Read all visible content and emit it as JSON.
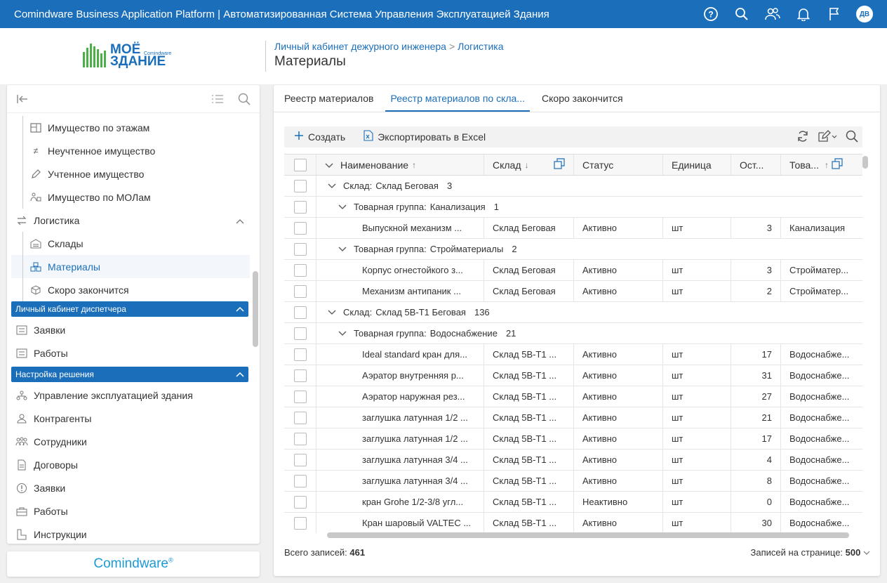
{
  "app": {
    "title": "Comindware Business Application Platform  |  Автоматизированная Система Управления Эксплуатацией Здания",
    "avatar": "ДВ",
    "logo_line1": "МОЁ",
    "logo_line2": "ЗДАНИЕ",
    "logo_small": "Comindware",
    "brand": "Comindware",
    "brand_mark": "®"
  },
  "breadcrumb": {
    "items": [
      "Личный кабинет дежурного инженера",
      "Логистика"
    ],
    "separator": ">",
    "page_title": "Материалы"
  },
  "sidebar": {
    "items": [
      {
        "label": "Имущество по этажам",
        "icon": "floor-plan-icon"
      },
      {
        "label": "Неучтенное имущество",
        "icon": "not-equal-icon"
      },
      {
        "label": "Учтенное имущество",
        "icon": "pencil-icon"
      },
      {
        "label": "Имущество по МОЛам",
        "icon": "person-box-icon"
      },
      {
        "label": "Логистика",
        "icon": "transfer-arrows-icon"
      },
      {
        "label": "Склады",
        "icon": "warehouse-icon"
      },
      {
        "label": "Материалы",
        "icon": "boxes-icon"
      },
      {
        "label": "Скоро закончится",
        "icon": "cube-icon"
      }
    ],
    "section_dispatcher": "Личный кабинет диспетчера",
    "dispatcher_items": [
      {
        "label": "Заявки",
        "icon": "list-icon"
      },
      {
        "label": "Работы",
        "icon": "list-icon"
      }
    ],
    "section_settings": "Настройка решения",
    "settings_items": [
      {
        "label": "Управление эксплуатацией здания",
        "icon": "sitemap-icon"
      },
      {
        "label": "Контрагенты",
        "icon": "contractor-icon"
      },
      {
        "label": "Сотрудники",
        "icon": "people-icon"
      },
      {
        "label": "Договоры",
        "icon": "document-icon"
      },
      {
        "label": "Заявки",
        "icon": "alert-circle-icon"
      },
      {
        "label": "Работы",
        "icon": "briefcase-icon"
      },
      {
        "label": "Инструкции",
        "icon": "instruction-icon"
      }
    ]
  },
  "tabs": [
    "Реестр материалов",
    "Реестр материалов по скла...",
    "Скоро закончится"
  ],
  "active_tab": 1,
  "toolbar": {
    "create": "Создать",
    "export": "Экспортировать в Excel"
  },
  "grid": {
    "headers": {
      "name": "Наименование",
      "warehouse": "Склад",
      "status": "Статус",
      "unit": "Единица",
      "remaining": "Ост...",
      "group": "Това..."
    },
    "sort_up": "↑",
    "sort_down": "↓",
    "rows": [
      {
        "kind": "group",
        "level": 0,
        "label": "Склад:",
        "value": "Склад Беговая",
        "count": "3"
      },
      {
        "kind": "group",
        "level": 1,
        "label": "Товарная группа:",
        "value": "Канализация",
        "count": "1"
      },
      {
        "kind": "data",
        "name": "Выпускной механизм ...",
        "warehouse": "Склад Беговая",
        "status": "Активно",
        "unit": "шт",
        "remaining": "3",
        "group": "Канализация"
      },
      {
        "kind": "group",
        "level": 1,
        "label": "Товарная группа:",
        "value": "Стройматериалы",
        "count": "2"
      },
      {
        "kind": "data",
        "name": "Корпус огнестойкого з...",
        "warehouse": "Склад Беговая",
        "status": "Активно",
        "unit": "шт",
        "remaining": "3",
        "group": "Стройматер..."
      },
      {
        "kind": "data",
        "name": "Механизм антипаник ...",
        "warehouse": "Склад Беговая",
        "status": "Активно",
        "unit": "шт",
        "remaining": "2",
        "group": "Стройматер..."
      },
      {
        "kind": "group",
        "level": 0,
        "label": "Склад:",
        "value": "Склад 5В-Т1 Беговая",
        "count": "136"
      },
      {
        "kind": "group",
        "level": 1,
        "label": "Товарная группа:",
        "value": "Водоснабжение",
        "count": "21"
      },
      {
        "kind": "data",
        "name": "Ideal standard кран для...",
        "warehouse": "Склад 5В-Т1 ...",
        "status": "Активно",
        "unit": "шт",
        "remaining": "17",
        "group": "Водоснабже..."
      },
      {
        "kind": "data",
        "name": "Аэратор внутренняя р...",
        "warehouse": "Склад 5В-Т1 ...",
        "status": "Активно",
        "unit": "шт",
        "remaining": "31",
        "group": "Водоснабже..."
      },
      {
        "kind": "data",
        "name": "Аэратор наружная рез...",
        "warehouse": "Склад 5В-Т1 ...",
        "status": "Активно",
        "unit": "шт",
        "remaining": "27",
        "group": "Водоснабже..."
      },
      {
        "kind": "data",
        "name": "заглушка латунная 1/2 ...",
        "warehouse": "Склад 5В-Т1 ...",
        "status": "Активно",
        "unit": "шт",
        "remaining": "21",
        "group": "Водоснабже..."
      },
      {
        "kind": "data",
        "name": "заглушка латунная 1/2 ...",
        "warehouse": "Склад 5В-Т1 ...",
        "status": "Активно",
        "unit": "шт",
        "remaining": "17",
        "group": "Водоснабже..."
      },
      {
        "kind": "data",
        "name": "заглушка латунная 3/4 ...",
        "warehouse": "Склад 5В-Т1 ...",
        "status": "Активно",
        "unit": "шт",
        "remaining": "4",
        "group": "Водоснабже..."
      },
      {
        "kind": "data",
        "name": "заглушка латунная 3/4 ...",
        "warehouse": "Склад 5В-Т1 ...",
        "status": "Активно",
        "unit": "шт",
        "remaining": "8",
        "group": "Водоснабже..."
      },
      {
        "kind": "data",
        "name": "кран Grohe 1/2-3/8 угл...",
        "warehouse": "Склад 5В-Т1 ...",
        "status": "Неактивно",
        "unit": "шт",
        "remaining": "0",
        "group": "Водоснабже..."
      },
      {
        "kind": "data",
        "name": "Кран шаровый VALTEC ...",
        "warehouse": "Склад 5В-Т1 ...",
        "status": "Активно",
        "unit": "шт",
        "remaining": "30",
        "group": "Водоснабже..."
      }
    ]
  },
  "footer": {
    "total_label": "Всего записей:",
    "total_value": "461",
    "per_page_label": "Записей на странице:",
    "per_page_value": "500"
  }
}
